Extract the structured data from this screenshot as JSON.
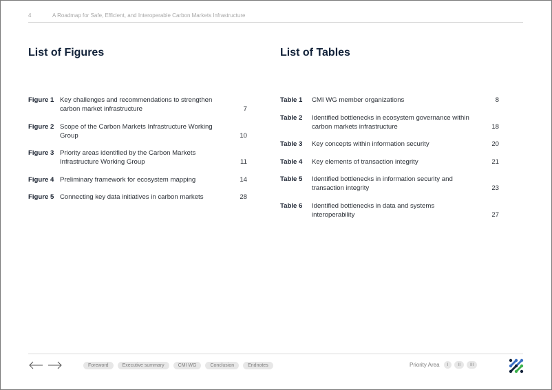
{
  "header": {
    "page_number": "4",
    "doc_title": "A Roadmap for Safe, Efficient, and Interoperable Carbon Markets Infrastructure"
  },
  "figures": {
    "heading": "List of Figures",
    "items": [
      {
        "label": "Figure 1",
        "title": "Key challenges and recommendations to strengthen carbon market infrastructure",
        "page": "7"
      },
      {
        "label": "Figure 2",
        "title": "Scope of the Carbon Markets Infrastructure Working Group",
        "page": "10"
      },
      {
        "label": "Figure 3",
        "title": "Priority areas identified by the Carbon Markets Infrastructure Working Group",
        "page": "11"
      },
      {
        "label": "Figure 4",
        "title": "Preliminary framework for ecosystem mapping",
        "page": "14"
      },
      {
        "label": "Figure 5",
        "title": "Connecting key data initiatives in carbon markets",
        "page": "28"
      }
    ]
  },
  "tables": {
    "heading": "List of Tables",
    "items": [
      {
        "label": "Table 1",
        "title": "CMI WG member organizations",
        "page": "8"
      },
      {
        "label": "Table 2",
        "title": "Identified bottlenecks in ecosystem governance within carbon markets infrastructure",
        "page": "18"
      },
      {
        "label": "Table 3",
        "title": "Key concepts within information security",
        "page": "20"
      },
      {
        "label": "Table 4",
        "title": "Key elements of transaction integrity",
        "page": "21"
      },
      {
        "label": "Table 5",
        "title": "Identified bottlenecks in information security and transaction integrity",
        "page": "23"
      },
      {
        "label": "Table 6",
        "title": "Identified bottlenecks in data and systems interoperability",
        "page": "27"
      }
    ]
  },
  "footer": {
    "nav": {
      "prev_icon": "arrow-left-icon",
      "next_icon": "arrow-right-icon"
    },
    "sections": [
      "Foreword",
      "Executive summary",
      "CMI WG",
      "Conclusion",
      "Endnotes"
    ],
    "priority_label": "Priority Area",
    "priority_areas": [
      "I",
      "II",
      "III"
    ],
    "logo_colors": {
      "navy": "#13233a",
      "blue": "#3a6fc4",
      "green": "#3bb04a"
    }
  }
}
